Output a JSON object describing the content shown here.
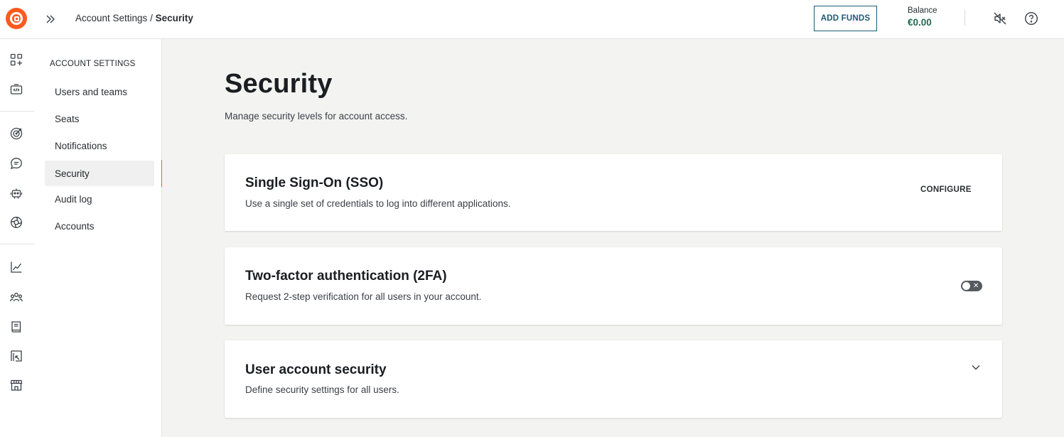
{
  "header": {
    "breadcrumb_parent": "Account Settings",
    "breadcrumb_separator": " / ",
    "breadcrumb_current": "Security",
    "add_funds_label": "ADD FUNDS",
    "balance_label": "Balance",
    "balance_value": "€0.00"
  },
  "rail": {
    "icons": [
      "apps-add-icon",
      "code-box-icon",
      "target-icon",
      "chat-icon",
      "robot-icon",
      "openai-icon",
      "line-chart-icon",
      "team-icon",
      "book-icon",
      "board-icon",
      "store-icon"
    ]
  },
  "sidebar": {
    "heading": "ACCOUNT SETTINGS",
    "items": [
      {
        "label": "Users and teams"
      },
      {
        "label": "Seats"
      },
      {
        "label": "Notifications"
      },
      {
        "label": "Security"
      },
      {
        "label": "Audit log"
      },
      {
        "label": "Accounts"
      }
    ],
    "active_index": 3
  },
  "main": {
    "title": "Security",
    "subtitle": "Manage security levels for account access.",
    "cards": [
      {
        "title": "Single Sign-On (SSO)",
        "description": "Use a single set of credentials to log into different applications.",
        "action_label": "CONFIGURE"
      },
      {
        "title": "Two-factor authentication (2FA)",
        "description": "Request 2-step verification for all users in your account.",
        "toggle_on": false
      },
      {
        "title": "User account security",
        "description": "Define security settings for all users."
      }
    ]
  },
  "colors": {
    "brand": "#ff5a1f",
    "accent": "#1c5b73",
    "balance": "#1e6b52",
    "main_bg": "#f3f3f2"
  }
}
